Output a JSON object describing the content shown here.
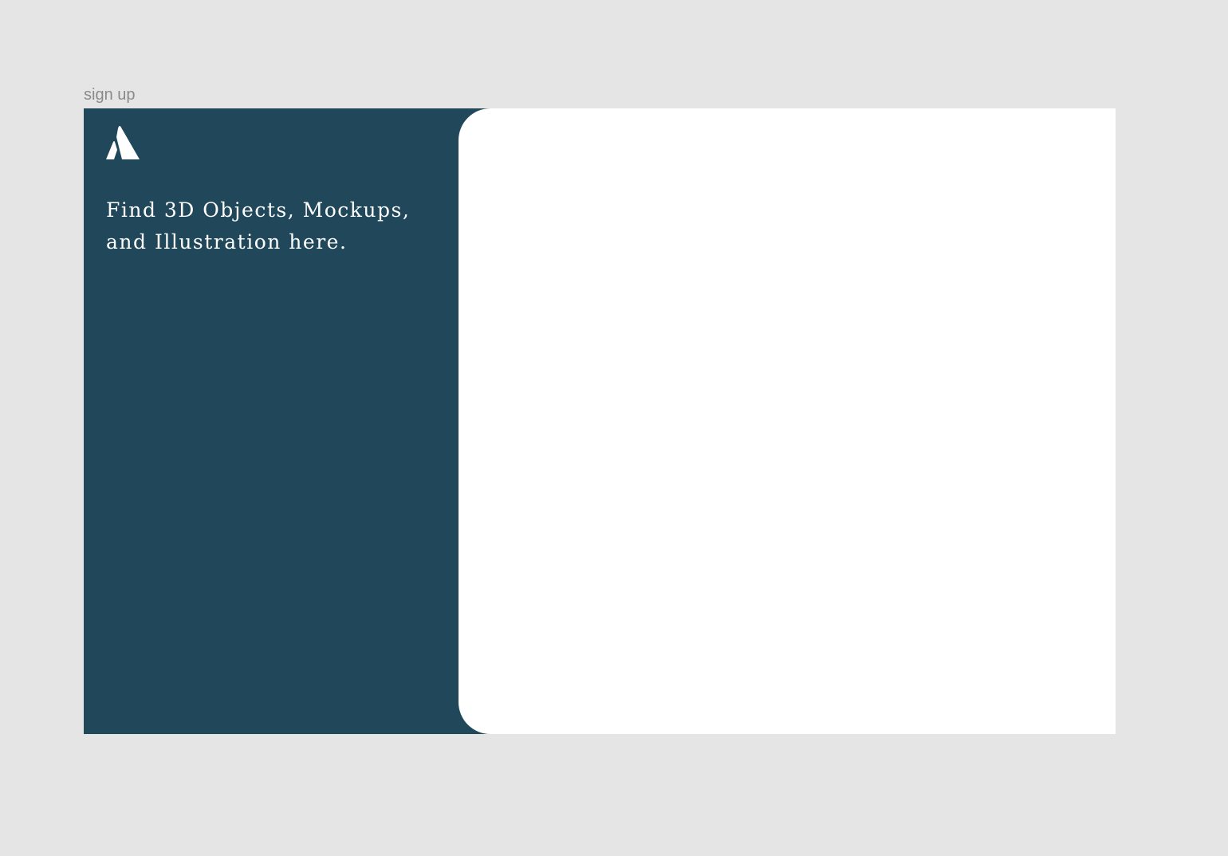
{
  "frame": {
    "label": "sign up"
  },
  "left_panel": {
    "logo_icon": "mountain-peak-icon",
    "tagline": "Find 3D Objects, Mockups, and Illustration here.",
    "background_color": "#20485a",
    "text_color": "#ffffff"
  },
  "right_panel": {
    "background_color": "#ffffff"
  },
  "canvas": {
    "background_color": "#e5e5e5"
  }
}
